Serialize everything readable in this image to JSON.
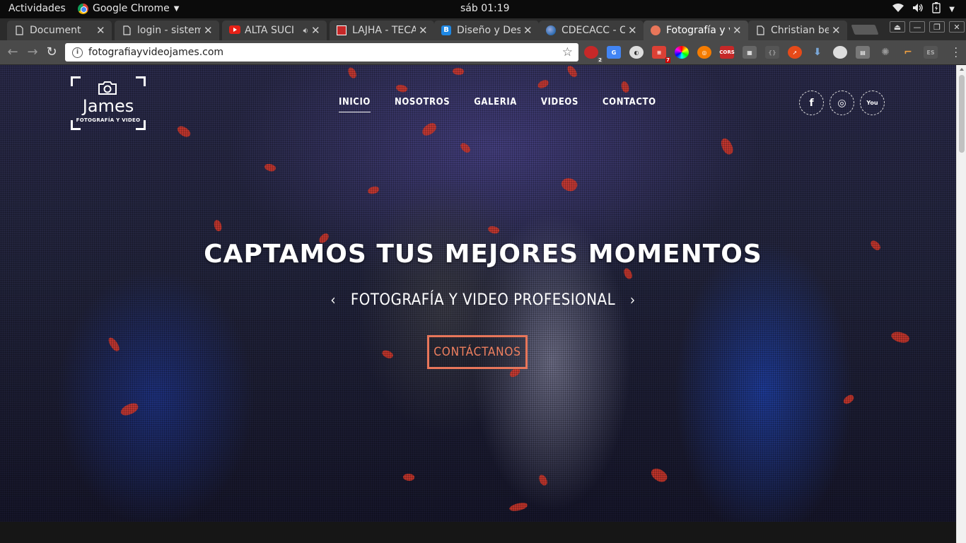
{
  "system_bar": {
    "activities": "Actividades",
    "app_name": "Google Chrome",
    "clock": "sáb 01:19"
  },
  "tabs": [
    {
      "label": "Document",
      "icon": "document-icon",
      "active": false
    },
    {
      "label": "login - sistem",
      "icon": "document-icon",
      "active": false
    },
    {
      "label": "ALTA SUCI",
      "icon": "youtube-icon",
      "active": false,
      "audio": true
    },
    {
      "label": "LAJHA - TECA",
      "icon": "pdf-icon",
      "active": false
    },
    {
      "label": "Diseño y Des",
      "icon": "blogger-icon",
      "active": false
    },
    {
      "label": "CDECACC - C",
      "icon": "globe-icon",
      "active": false
    },
    {
      "label": "Fotografía y v",
      "icon": "camera-favicon-icon",
      "active": true
    },
    {
      "label": "Christian ben",
      "icon": "document-icon",
      "active": false
    }
  ],
  "toolbar": {
    "url": "fotografiayvideojames.com",
    "extension_badges": {
      "adblock": "2",
      "todoist": "7",
      "cors": "CORS"
    }
  },
  "page": {
    "logo": {
      "name": "James",
      "tagline": "FOTOGRAFÍA Y VIDEO"
    },
    "nav": [
      "INICIO",
      "NOSOTROS",
      "GALERIA",
      "VIDEOS",
      "CONTACTO"
    ],
    "nav_active": "INICIO",
    "social": [
      {
        "name": "facebook",
        "glyph": "f"
      },
      {
        "name": "instagram",
        "glyph": "◎"
      },
      {
        "name": "youtube",
        "glyph": "You"
      }
    ],
    "headline": "CAPTAMOS TUS MEJORES MOMENTOS",
    "subheadline": "FOTOGRAFÍA Y VIDEO PROFESIONAL",
    "arrow_prev": "‹",
    "arrow_next": "›",
    "cta": "CONTÁCTANOS"
  },
  "colors": {
    "accent": "#e8765a",
    "tab_active": "#4a4a4a",
    "petal": "#d8382a"
  }
}
